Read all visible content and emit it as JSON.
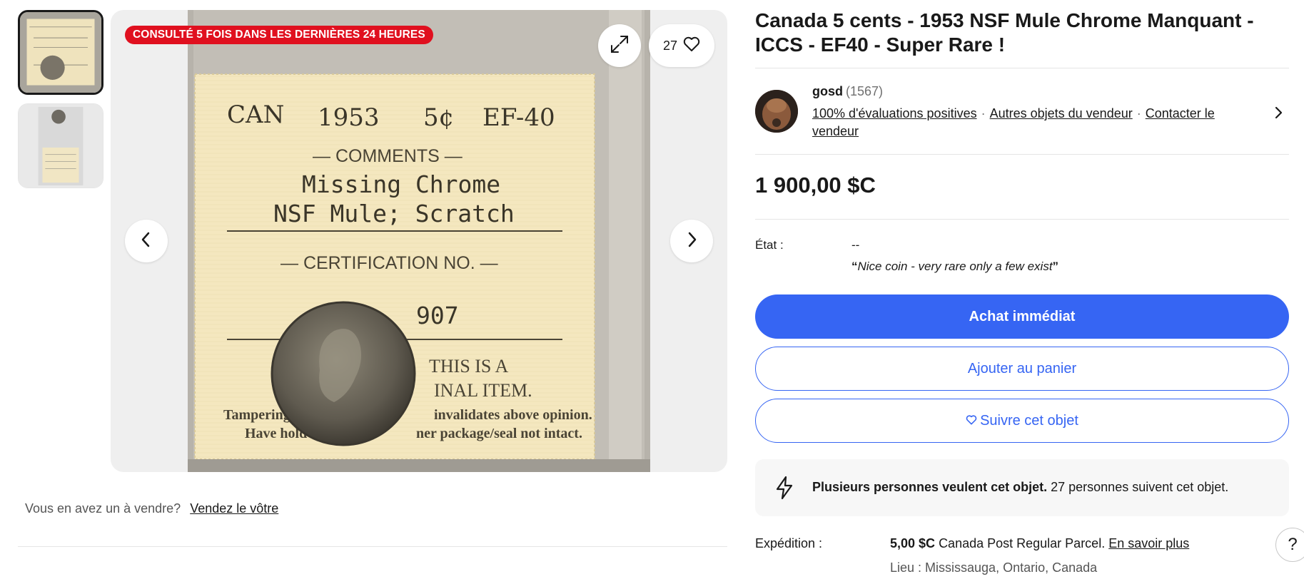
{
  "thumbnails": [
    {
      "alt": "Coin holder front",
      "selected": true
    },
    {
      "alt": "Coin holder back",
      "selected": false
    }
  ],
  "gallery": {
    "badge": "CONSULTÉ 5 FOIS DANS LES DERNIÈRES 24 HEURES",
    "watch_count": "27",
    "photo_text": {
      "can": "CAN",
      "year": "1953",
      "denom": "5¢",
      "grade": "EF-40",
      "comments_title": "— COMMENTS —",
      "comment_line1": "Missing Chrome",
      "comment_line2": "NSF Mule; Scratch",
      "cert_title": "— CERTIFICATION NO. —",
      "cert_no": "907",
      "notice1": "THIS IS A",
      "notice2": "INAL ITEM.",
      "tamper1": "Tampering",
      "tamper2": "invalidates above opinion.",
      "tamper3": "Have hold",
      "tamper4": "ner package/seal not intact."
    }
  },
  "sell_row": {
    "question": "Vous en avez un à vendre?",
    "link": "Vendez le vôtre"
  },
  "listing": {
    "title": "Canada 5 cents - 1953 NSF Mule Chrome Manquant - ICCS - EF40 - Super Rare !",
    "price": "1 900,00 $C"
  },
  "seller": {
    "name": "gosd",
    "feedback_count": "(1567)",
    "links": {
      "positive": "100% d'évaluations positives",
      "other_items": "Autres objets du vendeur",
      "contact": "Contacter le vendeur"
    }
  },
  "condition": {
    "label": "État :",
    "value": "--",
    "quote": "Nice coin - very rare only a few exist"
  },
  "buttons": {
    "buy_now": "Achat immédiat",
    "add_to_cart": "Ajouter au panier",
    "watch": "Suivre cet objet"
  },
  "demand": {
    "bold": "Plusieurs personnes veulent cet objet.",
    "text": "27 personnes suivent cet objet."
  },
  "shipping": {
    "label": "Expédition :",
    "cost": "5,00 $C",
    "service": "Canada Post Regular Parcel.",
    "link": "En savoir plus",
    "location": "Lieu : Mississauga, Ontario, Canada"
  },
  "help": "?",
  "colors": {
    "accent": "#3665f3",
    "badge": "#e0101f",
    "text": "#191919"
  }
}
